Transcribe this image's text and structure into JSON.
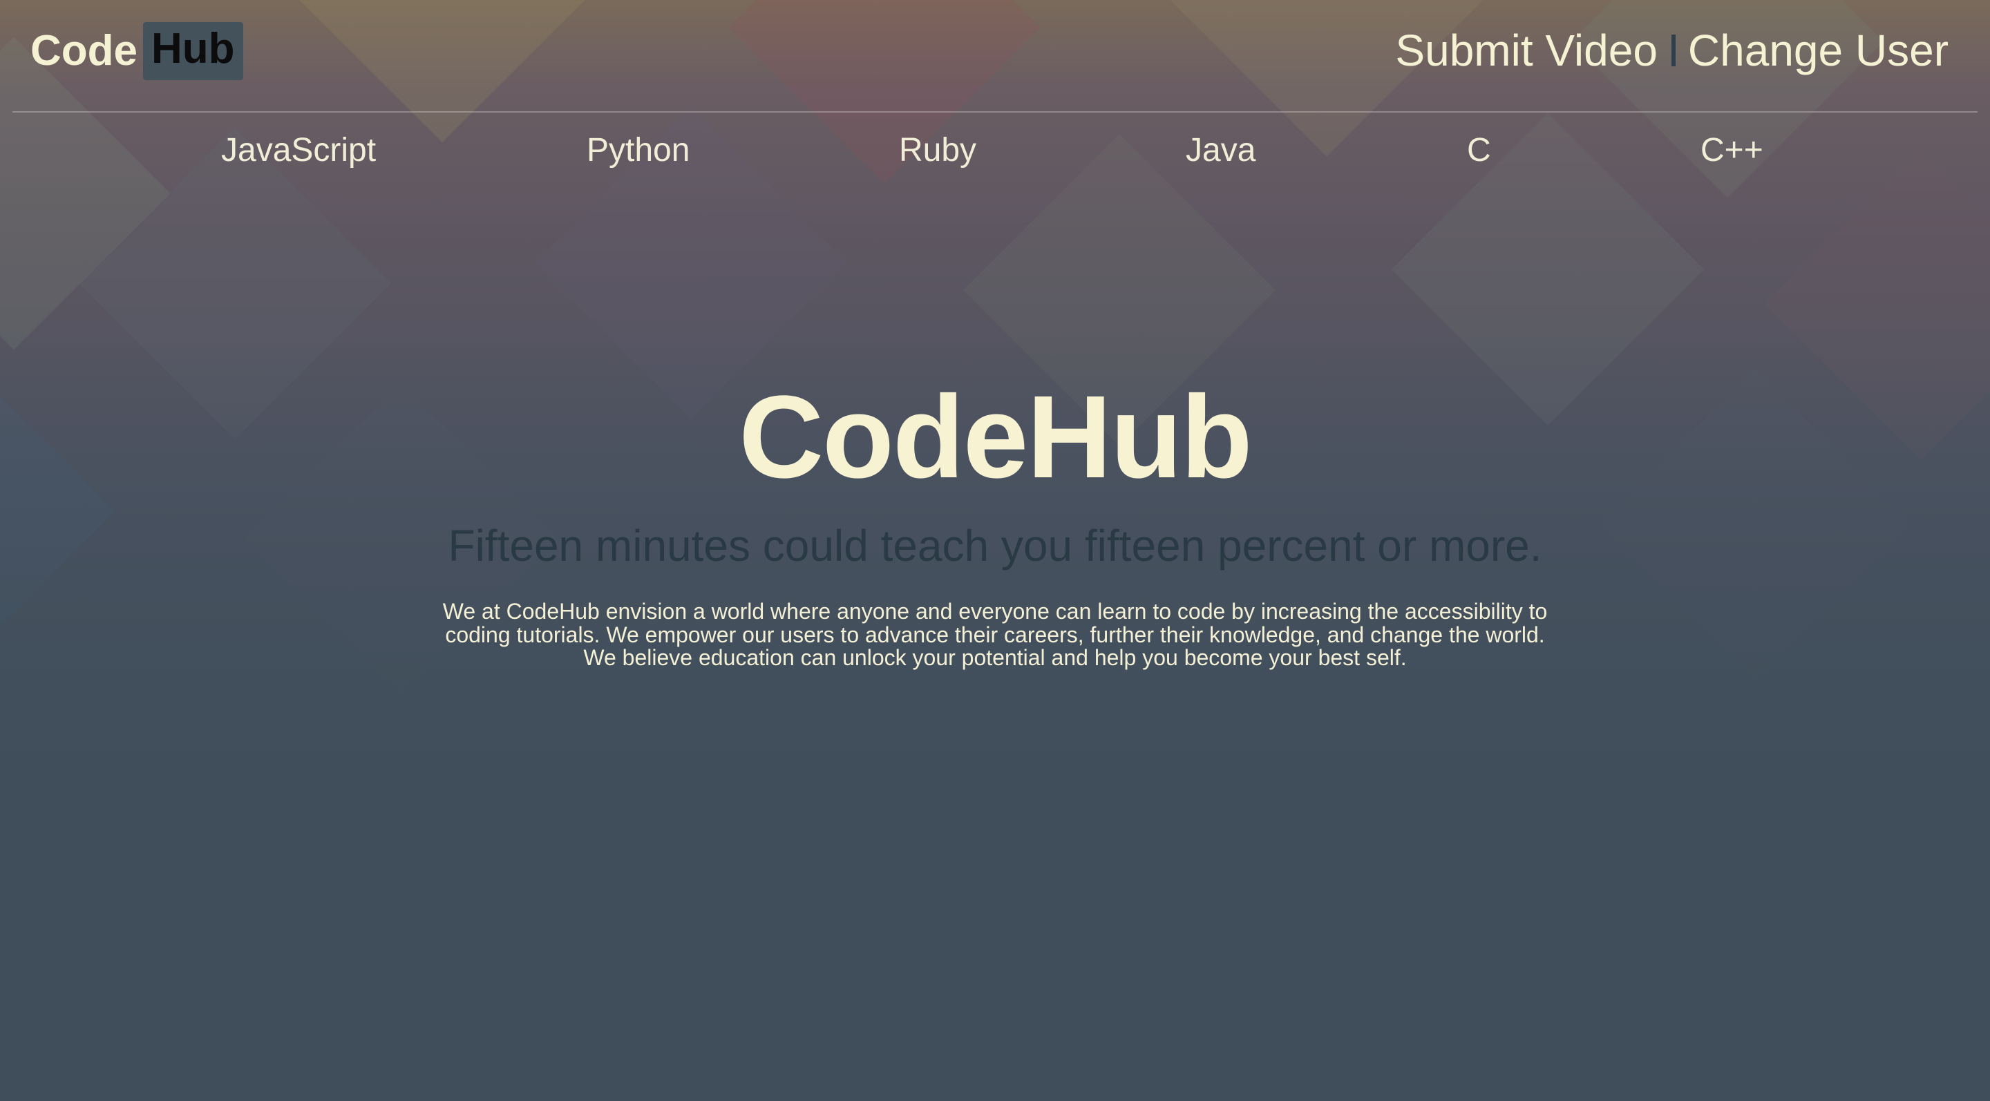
{
  "header": {
    "logo_code": "Code",
    "logo_hub": "Hub",
    "links": {
      "submit_video": "Submit Video",
      "change_user": "Change User"
    }
  },
  "nav": {
    "items": [
      {
        "label": "JavaScript"
      },
      {
        "label": "Python"
      },
      {
        "label": "Ruby"
      },
      {
        "label": "Java"
      },
      {
        "label": "C"
      },
      {
        "label": "C++"
      }
    ]
  },
  "hero": {
    "title": "CodeHub",
    "subtitle": "Fifteen minutes could teach you fifteen percent or more.",
    "body": "We at CodeHub envision a world where anyone and everyone can learn to code by increasing the accessibility to coding tutorials. We empower our users to advance their careers, further their knowledge, and change the world. We believe education can unlock your potential and help you become your best self."
  },
  "colors": {
    "accent_cream": "#f5f1d3",
    "logo_hub_bg": "#44525c",
    "subtitle_dark": "#2a3a45",
    "background_base": "#404e5b"
  }
}
